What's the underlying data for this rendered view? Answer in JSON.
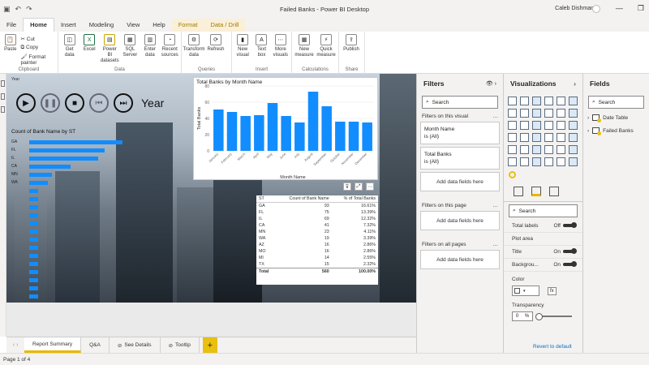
{
  "window": {
    "title": "Failed Banks - Power BI Desktop",
    "user": "Caleb Dishman"
  },
  "ribbon_tabs": [
    "File",
    "Home",
    "Insert",
    "Modeling",
    "View",
    "Help",
    "Format",
    "Data / Drill"
  ],
  "ribbon": {
    "clipboard": {
      "paste": "Paste",
      "cut": "Cut",
      "copy": "Copy",
      "format_painter": "Format painter",
      "group": "Clipboard"
    },
    "data": {
      "buttons": [
        {
          "label": "Get data",
          "icon": "database-icon"
        },
        {
          "label": "Excel",
          "icon": "excel-icon"
        },
        {
          "label": "Power BI datasets",
          "icon": "dataset-icon"
        },
        {
          "label": "SQL Server",
          "icon": "sql-icon"
        },
        {
          "label": "Enter data",
          "icon": "table-icon"
        },
        {
          "label": "Recent sources",
          "icon": "recent-icon"
        }
      ],
      "group": "Data"
    },
    "queries": {
      "buttons": [
        {
          "label": "Transform data",
          "icon": "transform-icon"
        },
        {
          "label": "Refresh",
          "icon": "refresh-icon"
        }
      ],
      "group": "Queries"
    },
    "insert": {
      "buttons": [
        {
          "label": "New visual",
          "icon": "chart-icon"
        },
        {
          "label": "Text box",
          "icon": "textbox-icon"
        },
        {
          "label": "More visuals",
          "icon": "visuals-icon"
        }
      ],
      "group": "Insert"
    },
    "calculations": {
      "buttons": [
        {
          "label": "New measure",
          "icon": "measure-icon"
        },
        {
          "label": "Quick measure",
          "icon": "quick-measure-icon"
        }
      ],
      "group": "Calculations"
    },
    "share": {
      "buttons": [
        {
          "label": "Publish",
          "icon": "publish-icon"
        }
      ],
      "group": "Share"
    }
  },
  "canvas": {
    "play_axis": {
      "label": "Year",
      "field_label": "Year"
    },
    "hbar_chart": {
      "title": "Count of Bank Name by ST"
    },
    "table": {
      "headers": [
        "ST",
        "Count of Bank Name",
        "% of Total Banks"
      ],
      "rows": [
        [
          "GA",
          "93",
          "16.61%"
        ],
        [
          "FL",
          "75",
          "13.39%"
        ],
        [
          "IL",
          "69",
          "12.32%"
        ],
        [
          "CA",
          "41",
          "7.32%"
        ],
        [
          "MN",
          "23",
          "4.11%"
        ],
        [
          "WA",
          "19",
          "3.39%"
        ],
        [
          "AZ",
          "16",
          "2.86%"
        ],
        [
          "MO",
          "16",
          "2.86%"
        ],
        [
          "MI",
          "14",
          "2.55%"
        ],
        [
          "TX",
          "15",
          "2.32%"
        ]
      ],
      "total": [
        "Total",
        "560",
        "100.00%"
      ]
    }
  },
  "chart_data": [
    {
      "type": "bar",
      "title": "Total Banks by Month Name",
      "xlabel": "Month Name",
      "ylabel": "Total Banks",
      "categories": [
        "January",
        "February",
        "March",
        "April",
        "May",
        "June",
        "July",
        "August",
        "September",
        "October",
        "November",
        "December"
      ],
      "values": [
        51,
        48,
        43,
        44,
        59,
        43,
        35,
        73,
        55,
        36,
        36,
        35
      ],
      "ylim": [
        0,
        80
      ],
      "yticks": [
        0,
        20,
        40,
        60,
        80
      ],
      "color": "#118dff"
    },
    {
      "type": "bar",
      "orientation": "horizontal",
      "title": "Count of Bank Name by ST",
      "categories": [
        "GA",
        "FL",
        "IL",
        "CA",
        "MN",
        "WA"
      ],
      "values": [
        93,
        75,
        69,
        41,
        23,
        19
      ],
      "color": "#118dff"
    }
  ],
  "page_tabs": [
    "Report Summary",
    "Q&A",
    "See Details",
    "Tooltip"
  ],
  "status": {
    "page": "Page 1 of 4"
  },
  "filters": {
    "title": "Filters",
    "search_placeholder": "Search",
    "on_visual": "Filters on this visual",
    "cards": [
      {
        "field": "Month Name",
        "value": "is (All)"
      },
      {
        "field": "Total Banks",
        "value": "is (All)"
      }
    ],
    "add_fields": "Add data fields here",
    "on_page": "Filters on this page",
    "on_all": "Filters on all pages"
  },
  "visualizations": {
    "title": "Visualizations",
    "search_placeholder": "Search",
    "props": {
      "total_labels": "Total labels",
      "off": "Off",
      "plot_area": "Plot area",
      "title": "Title",
      "on": "On",
      "background": "Backgrou...",
      "color": "Color",
      "fx": "fx",
      "transparency": "Transparency",
      "transparency_value": "0",
      "percent": "%"
    },
    "revert": "Revert to default"
  },
  "fields_pane": {
    "title": "Fields",
    "search_placeholder": "Search",
    "tables": [
      "Date Table",
      "Failed Banks"
    ]
  }
}
